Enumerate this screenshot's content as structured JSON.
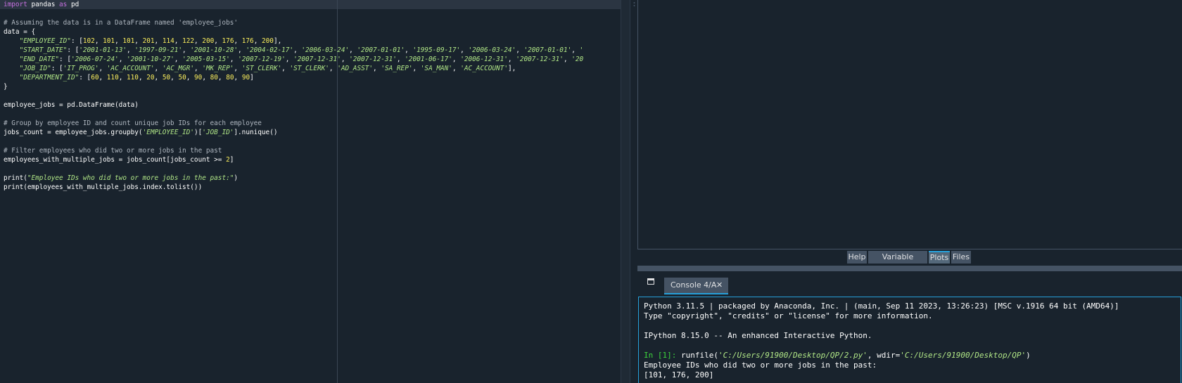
{
  "editor": {
    "lines": [
      [
        {
          "t": "import",
          "c": "kw"
        },
        {
          "t": " pandas ",
          "c": ""
        },
        {
          "t": "as",
          "c": "kw"
        },
        {
          "t": " pd",
          "c": ""
        }
      ],
      [],
      [
        {
          "t": "# Assuming the data is in a DataFrame named 'employee_jobs'",
          "c": "cm"
        }
      ],
      [
        {
          "t": "data = {",
          "c": ""
        }
      ],
      [
        {
          "t": "    ",
          "c": ""
        },
        {
          "t": "\"EMPLOYEE_ID\"",
          "c": "st"
        },
        {
          "t": ": [",
          "c": ""
        },
        {
          "t": "102",
          "c": "nu"
        },
        {
          "t": ", ",
          "c": ""
        },
        {
          "t": "101",
          "c": "nu"
        },
        {
          "t": ", ",
          "c": ""
        },
        {
          "t": "101",
          "c": "nu"
        },
        {
          "t": ", ",
          "c": ""
        },
        {
          "t": "201",
          "c": "nu"
        },
        {
          "t": ", ",
          "c": ""
        },
        {
          "t": "114",
          "c": "nu"
        },
        {
          "t": ", ",
          "c": ""
        },
        {
          "t": "122",
          "c": "nu"
        },
        {
          "t": ", ",
          "c": ""
        },
        {
          "t": "200",
          "c": "nu"
        },
        {
          "t": ", ",
          "c": ""
        },
        {
          "t": "176",
          "c": "nu"
        },
        {
          "t": ", ",
          "c": ""
        },
        {
          "t": "176",
          "c": "nu"
        },
        {
          "t": ", ",
          "c": ""
        },
        {
          "t": "200",
          "c": "nu"
        },
        {
          "t": "],",
          "c": ""
        }
      ],
      [
        {
          "t": "    ",
          "c": ""
        },
        {
          "t": "\"START_DATE\"",
          "c": "st"
        },
        {
          "t": ": [",
          "c": ""
        },
        {
          "t": "'2001-01-13'",
          "c": "st"
        },
        {
          "t": ", ",
          "c": ""
        },
        {
          "t": "'1997-09-21'",
          "c": "st"
        },
        {
          "t": ", ",
          "c": ""
        },
        {
          "t": "'2001-10-28'",
          "c": "st"
        },
        {
          "t": ", ",
          "c": ""
        },
        {
          "t": "'2004-02-17'",
          "c": "st"
        },
        {
          "t": ", ",
          "c": ""
        },
        {
          "t": "'2006-03-24'",
          "c": "st"
        },
        {
          "t": ", ",
          "c": ""
        },
        {
          "t": "'2007-01-01'",
          "c": "st"
        },
        {
          "t": ", ",
          "c": ""
        },
        {
          "t": "'1995-09-17'",
          "c": "st"
        },
        {
          "t": ", ",
          "c": ""
        },
        {
          "t": "'2006-03-24'",
          "c": "st"
        },
        {
          "t": ", ",
          "c": ""
        },
        {
          "t": "'2007-01-01'",
          "c": "st"
        },
        {
          "t": ", ",
          "c": ""
        },
        {
          "t": "'",
          "c": "st"
        }
      ],
      [
        {
          "t": "    ",
          "c": ""
        },
        {
          "t": "\"END_DATE\"",
          "c": "st"
        },
        {
          "t": ": [",
          "c": ""
        },
        {
          "t": "'2006-07-24'",
          "c": "st"
        },
        {
          "t": ", ",
          "c": ""
        },
        {
          "t": "'2001-10-27'",
          "c": "st"
        },
        {
          "t": ", ",
          "c": ""
        },
        {
          "t": "'2005-03-15'",
          "c": "st"
        },
        {
          "t": ", ",
          "c": ""
        },
        {
          "t": "'2007-12-19'",
          "c": "st"
        },
        {
          "t": ", ",
          "c": ""
        },
        {
          "t": "'2007-12-31'",
          "c": "st"
        },
        {
          "t": ", ",
          "c": ""
        },
        {
          "t": "'2007-12-31'",
          "c": "st"
        },
        {
          "t": ", ",
          "c": ""
        },
        {
          "t": "'2001-06-17'",
          "c": "st"
        },
        {
          "t": ", ",
          "c": ""
        },
        {
          "t": "'2006-12-31'",
          "c": "st"
        },
        {
          "t": ", ",
          "c": ""
        },
        {
          "t": "'2007-12-31'",
          "c": "st"
        },
        {
          "t": ", ",
          "c": ""
        },
        {
          "t": "'20",
          "c": "st"
        }
      ],
      [
        {
          "t": "    ",
          "c": ""
        },
        {
          "t": "\"JOB_ID\"",
          "c": "st"
        },
        {
          "t": ": [",
          "c": ""
        },
        {
          "t": "'IT_PROG'",
          "c": "st"
        },
        {
          "t": ", ",
          "c": ""
        },
        {
          "t": "'AC_ACCOUNT'",
          "c": "st"
        },
        {
          "t": ", ",
          "c": ""
        },
        {
          "t": "'AC_MGR'",
          "c": "st"
        },
        {
          "t": ", ",
          "c": ""
        },
        {
          "t": "'MK_REP'",
          "c": "st"
        },
        {
          "t": ", ",
          "c": ""
        },
        {
          "t": "'ST_CLERK'",
          "c": "st"
        },
        {
          "t": ", ",
          "c": ""
        },
        {
          "t": "'ST_CLERK'",
          "c": "st"
        },
        {
          "t": ", ",
          "c": ""
        },
        {
          "t": "'AD_ASST'",
          "c": "st"
        },
        {
          "t": ", ",
          "c": ""
        },
        {
          "t": "'SA_REP'",
          "c": "st"
        },
        {
          "t": ", ",
          "c": ""
        },
        {
          "t": "'SA_MAN'",
          "c": "st"
        },
        {
          "t": ", ",
          "c": ""
        },
        {
          "t": "'AC_ACCOUNT'",
          "c": "st"
        },
        {
          "t": "],",
          "c": ""
        }
      ],
      [
        {
          "t": "    ",
          "c": ""
        },
        {
          "t": "\"DEPARTMENT_ID\"",
          "c": "st"
        },
        {
          "t": ": [",
          "c": ""
        },
        {
          "t": "60",
          "c": "nu"
        },
        {
          "t": ", ",
          "c": ""
        },
        {
          "t": "110",
          "c": "nu"
        },
        {
          "t": ", ",
          "c": ""
        },
        {
          "t": "110",
          "c": "nu"
        },
        {
          "t": ", ",
          "c": ""
        },
        {
          "t": "20",
          "c": "nu"
        },
        {
          "t": ", ",
          "c": ""
        },
        {
          "t": "50",
          "c": "nu"
        },
        {
          "t": ", ",
          "c": ""
        },
        {
          "t": "50",
          "c": "nu"
        },
        {
          "t": ", ",
          "c": ""
        },
        {
          "t": "90",
          "c": "nu"
        },
        {
          "t": ", ",
          "c": ""
        },
        {
          "t": "80",
          "c": "nu"
        },
        {
          "t": ", ",
          "c": ""
        },
        {
          "t": "80",
          "c": "nu"
        },
        {
          "t": ", ",
          "c": ""
        },
        {
          "t": "90",
          "c": "nu"
        },
        {
          "t": "]",
          "c": ""
        }
      ],
      [
        {
          "t": "}",
          "c": ""
        }
      ],
      [],
      [
        {
          "t": "employee_jobs = pd.DataFrame(data)",
          "c": ""
        }
      ],
      [],
      [
        {
          "t": "# Group by employee ID and count unique job IDs for each employee",
          "c": "cm"
        }
      ],
      [
        {
          "t": "jobs_count = employee_jobs.groupby(",
          "c": ""
        },
        {
          "t": "'EMPLOYEE_ID'",
          "c": "st"
        },
        {
          "t": ")[",
          "c": ""
        },
        {
          "t": "'JOB_ID'",
          "c": "st"
        },
        {
          "t": "].nunique()",
          "c": ""
        }
      ],
      [],
      [
        {
          "t": "# Filter employees who did two or more jobs in the past",
          "c": "cm"
        }
      ],
      [
        {
          "t": "employees_with_multiple_jobs = jobs_count[jobs_count >= ",
          "c": ""
        },
        {
          "t": "2",
          "c": "nu"
        },
        {
          "t": "]",
          "c": ""
        }
      ],
      [],
      [
        {
          "t": "print(",
          "c": ""
        },
        {
          "t": "\"Employee IDs who did two or more jobs in the past:\"",
          "c": "st"
        },
        {
          "t": ")",
          "c": ""
        }
      ],
      [
        {
          "t": "print(employees_with_multiple_jobs.index.tolist())",
          "c": ""
        }
      ]
    ]
  },
  "panes": {
    "tabs": [
      {
        "label": "Help",
        "name": "tab-help",
        "active": false
      },
      {
        "label": "Variable Explorer",
        "name": "tab-variable-explorer",
        "active": false
      },
      {
        "label": "Plots",
        "name": "tab-plots",
        "active": true
      },
      {
        "label": "Files",
        "name": "tab-files",
        "active": false
      }
    ]
  },
  "console": {
    "tab_label": "Console 4/A",
    "close_glyph": "✕",
    "lines": [
      [
        {
          "t": "Python 3.11.5 | packaged by Anaconda, Inc. | (main, Sep 11 2023, 13:26:23) [MSC v.1916 64 bit (AMD64)]",
          "c": ""
        }
      ],
      [
        {
          "t": "Type \"copyright\", \"credits\" or \"license\" for more information.",
          "c": ""
        }
      ],
      [],
      [
        {
          "t": "IPython 8.15.0 -- An enhanced Interactive Python.",
          "c": ""
        }
      ],
      [],
      [
        {
          "t": "In [",
          "c": "green"
        },
        {
          "t": "1",
          "c": "green"
        },
        {
          "t": "]: ",
          "c": "green"
        },
        {
          "t": "runfile(",
          "c": ""
        },
        {
          "t": "'C:/Users/91900/Desktop/QP/2.py'",
          "c": "cst"
        },
        {
          "t": ", wdir=",
          "c": ""
        },
        {
          "t": "'C:/Users/91900/Desktop/QP'",
          "c": "cst"
        },
        {
          "t": ")",
          "c": ""
        }
      ],
      [
        {
          "t": "Employee IDs who did two or more jobs in the past:",
          "c": ""
        }
      ],
      [
        {
          "t": "[101, 176, 200]",
          "c": ""
        }
      ]
    ]
  },
  "colors": {
    "background": "#19232d",
    "accent": "#26a0da",
    "keyword": "#c670e0",
    "string": "#b0e686",
    "number": "#faed5c",
    "comment": "#aeb6bf"
  }
}
